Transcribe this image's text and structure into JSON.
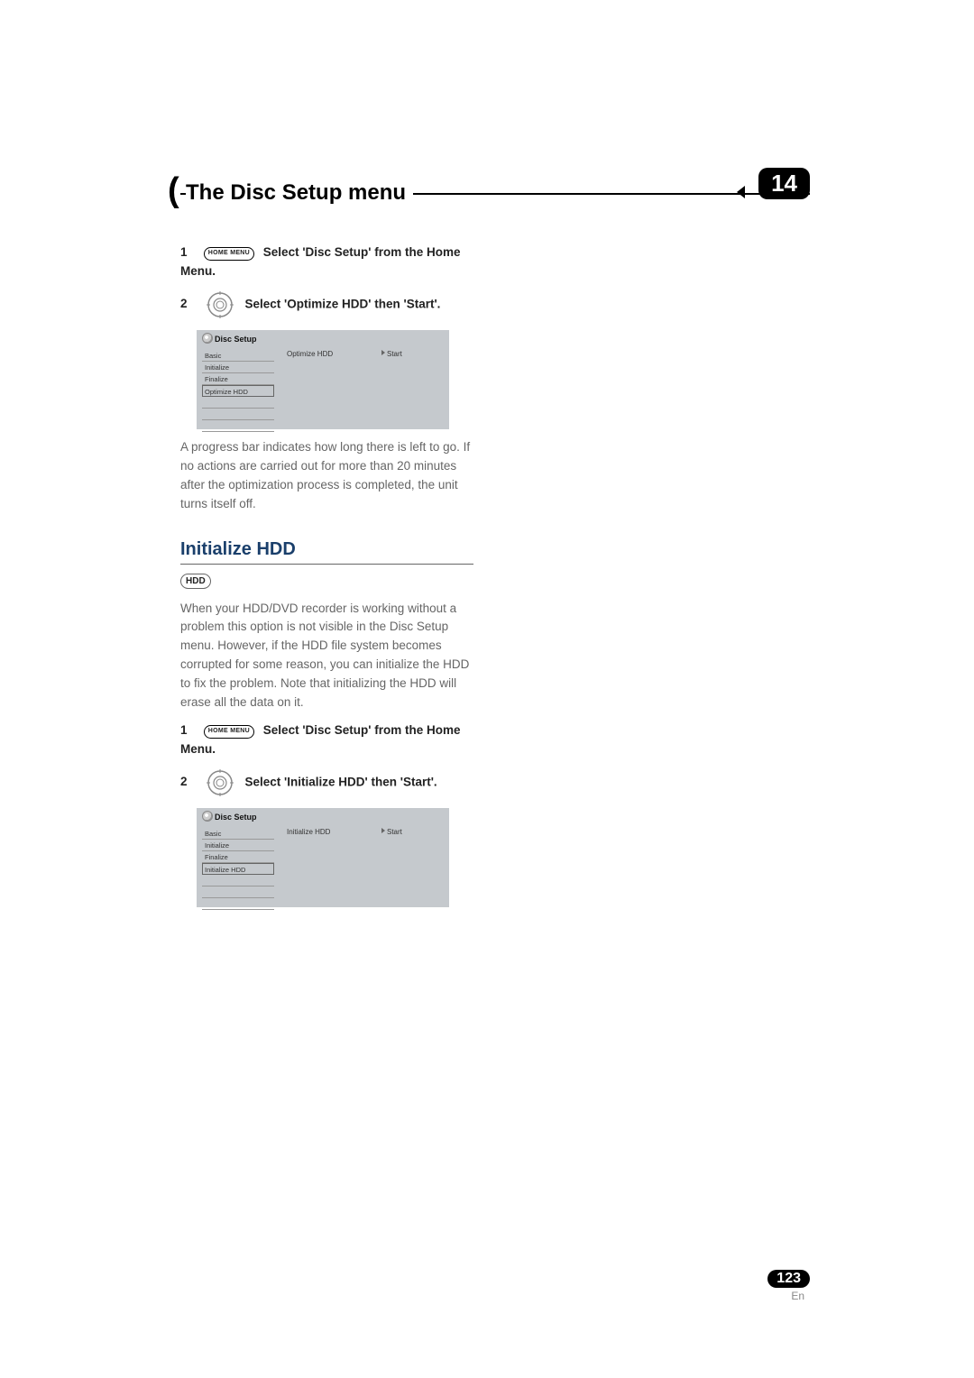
{
  "header": {
    "title": "The Disc Setup menu",
    "chapter_number": "14"
  },
  "optimize_section": {
    "step1_num": "1",
    "step1_keylabel": "HOME MENU",
    "step1_text": "Select 'Disc Setup' from the Home Menu.",
    "step2_num": "2",
    "step2_text": "Select 'Optimize HDD' then 'Start'.",
    "screenshot": {
      "title": "Disc Setup",
      "menu": [
        "Basic",
        "Initialize",
        "Finalize",
        "Optimize HDD"
      ],
      "selected_index": 3,
      "middle": "Optimize HDD",
      "right": "Start"
    },
    "body": "A progress bar indicates how long there is left to go. If no actions are carried out for more than 20 minutes after the optimization process is completed, the unit turns itself off."
  },
  "initialize_section": {
    "heading": "Initialize HDD",
    "badge": "HDD",
    "body": "When your HDD/DVD recorder is working without a problem this option is not visible in the Disc Setup menu. However, if the HDD file system becomes corrupted for some reason, you can initialize the HDD to fix the problem. Note that initializing the HDD will erase all the data on it.",
    "step1_num": "1",
    "step1_keylabel": "HOME MENU",
    "step1_text": "Select 'Disc Setup' from the Home Menu.",
    "step2_num": "2",
    "step2_text": "Select 'Initialize HDD' then 'Start'.",
    "screenshot": {
      "title": "Disc Setup",
      "menu": [
        "Basic",
        "Initialize",
        "Finalize",
        "Initialize HDD"
      ],
      "selected_index": 3,
      "middle": "Initialize HDD",
      "right": "Start"
    }
  },
  "footer": {
    "page_number": "123",
    "lang": "En"
  }
}
